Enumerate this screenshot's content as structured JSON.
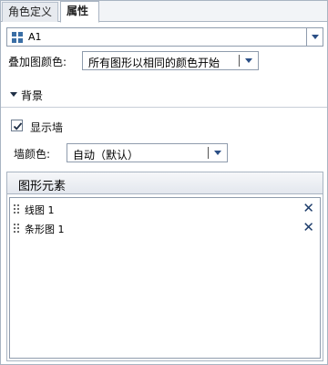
{
  "tabs": [
    {
      "label": "角色定义",
      "active": false
    },
    {
      "label": "属性",
      "active": true
    }
  ],
  "element_selector": {
    "value": "A1",
    "icon": "grid-icon"
  },
  "overlay_color": {
    "label": "叠加图颜色:",
    "value": "所有图形以相同的颜色开始"
  },
  "background_section": {
    "label": "背景",
    "expanded": true
  },
  "show_wall": {
    "label": "显示墙",
    "checked": true
  },
  "wall_color": {
    "label": "墙颜色:",
    "value": "自动（默认）"
  },
  "graph_elements": {
    "title": "图形元素",
    "items": [
      {
        "name": "线图 1"
      },
      {
        "name": "条形图 1"
      }
    ]
  },
  "colors": {
    "accent": "#1e3d6b",
    "border": "#a9b4c2",
    "icon_blue": "#3a6ea5"
  }
}
